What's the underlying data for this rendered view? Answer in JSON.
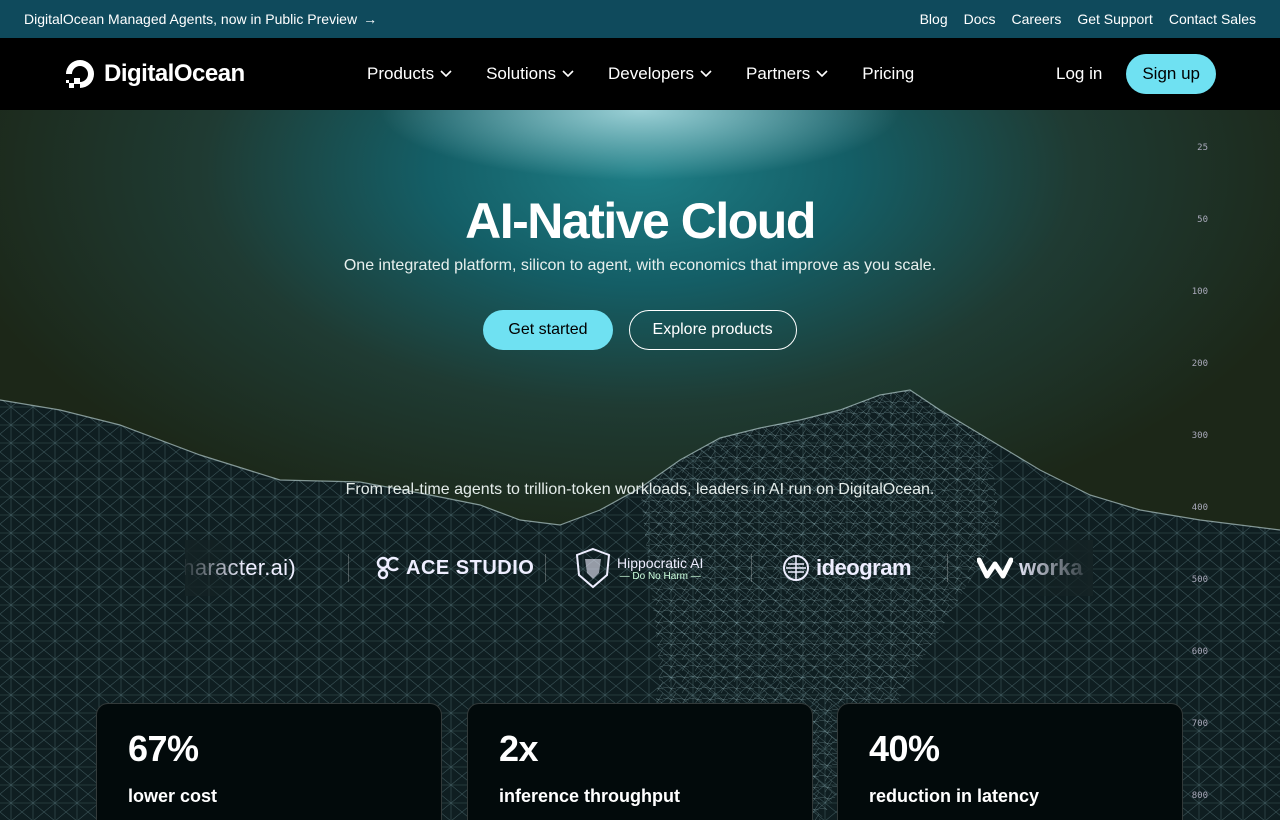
{
  "announcement": {
    "text": "DigitalOcean Managed Agents, now in Public Preview",
    "arrow": "→",
    "links": [
      "Blog",
      "Docs",
      "Careers",
      "Get Support",
      "Contact Sales"
    ]
  },
  "nav": {
    "brand": "DigitalOcean",
    "menu": [
      {
        "label": "Products",
        "dropdown": true
      },
      {
        "label": "Solutions",
        "dropdown": true
      },
      {
        "label": "Developers",
        "dropdown": true
      },
      {
        "label": "Partners",
        "dropdown": true
      },
      {
        "label": "Pricing",
        "dropdown": false
      }
    ],
    "login": "Log in",
    "signup": "Sign up"
  },
  "hero": {
    "title": "AI-Native Cloud",
    "subtitle": "One integrated platform, silicon to agent, with economics that improve as you scale.",
    "primary_cta": "Get started",
    "secondary_cta": "Explore products",
    "ruler": [
      "25",
      "50",
      "100",
      "200",
      "300",
      "400",
      "500",
      "600",
      "700",
      "800"
    ]
  },
  "customers": {
    "tagline": "From real-time agents to trillion-token workloads, leaders in AI run on DigitalOcean.",
    "logos": {
      "character": "character.ai)",
      "ace": "ACE STUDIO",
      "hippocratic": "Hippocratic AI",
      "hippocratic_sub": "— Do No Harm —",
      "ideogram": "ideogram",
      "workato": "worka"
    }
  },
  "stats": [
    {
      "value": "67%",
      "label": "lower cost"
    },
    {
      "value": "2x",
      "label": "inference throughput"
    },
    {
      "value": "40%",
      "label": "reduction in latency"
    }
  ],
  "colors": {
    "announcement_bg": "#0f4a5c",
    "accent": "#6fe1f2",
    "nav_bg": "#000000"
  }
}
